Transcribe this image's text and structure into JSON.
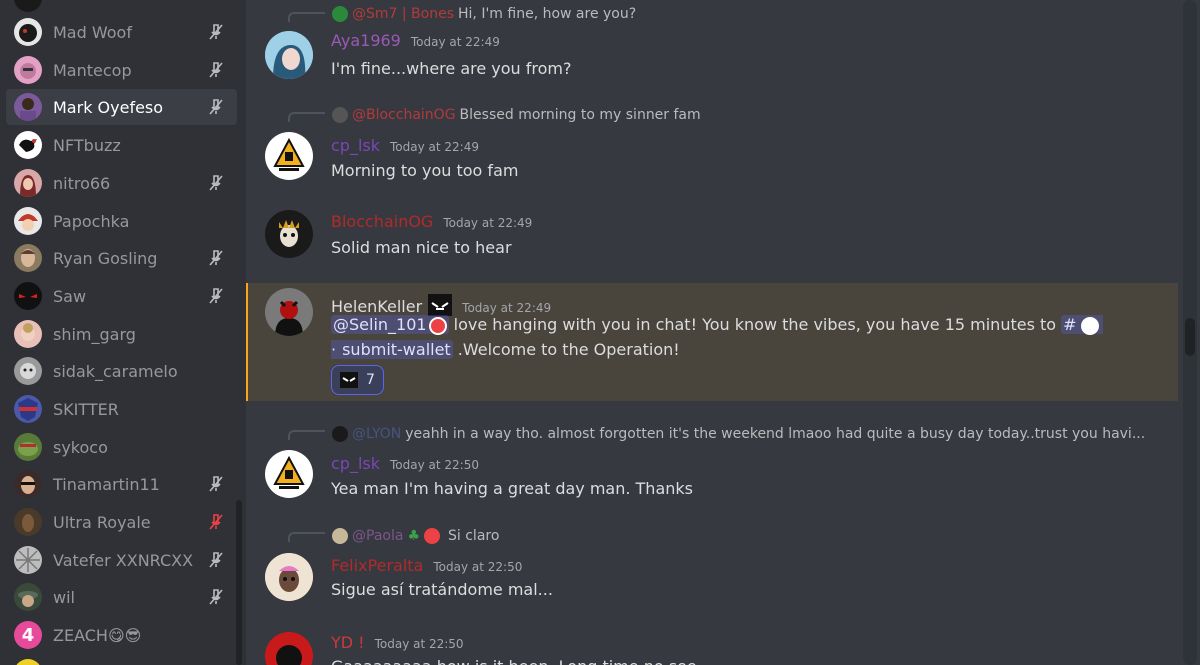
{
  "members": [
    {
      "name": "Mad Woof",
      "muted": true,
      "avatar_color": "#b9bbbe"
    },
    {
      "name": "Mantecop",
      "muted": true,
      "avatar_color": "#e3a1c6"
    },
    {
      "name": "Mark Oyefeso",
      "muted": true,
      "selected": true,
      "avatar_color": "#7a5a9a"
    },
    {
      "name": "NFTbuzz",
      "muted": false,
      "avatar_color": "#ffffff"
    },
    {
      "name": "nitro66",
      "muted": true,
      "avatar_color": "#a85a62"
    },
    {
      "name": "Papochka",
      "muted": false,
      "avatar_color": "#b83a32"
    },
    {
      "name": "Ryan Gosling",
      "muted": true,
      "avatar_color": "#8a7a60"
    },
    {
      "name": "Saw",
      "muted": true,
      "avatar_color": "#1a1a1a"
    },
    {
      "name": "shim_garg",
      "muted": false,
      "avatar_color": "#c98a8a"
    },
    {
      "name": "sidak_caramelo",
      "muted": false,
      "avatar_color": "#8a8a8a"
    },
    {
      "name": "SKITTER",
      "muted": false,
      "avatar_color": "#4a5aa8"
    },
    {
      "name": "sykoco",
      "muted": false,
      "avatar_color": "#6a8a4a"
    },
    {
      "name": "Tinamartin11",
      "muted": true,
      "avatar_color": "#3a2a2a"
    },
    {
      "name": "Ultra Royale",
      "muted": true,
      "mute_red": true,
      "avatar_color": "#4a3a2a"
    },
    {
      "name": "Vatefer XXNRCXX",
      "muted": true,
      "avatar_color": "#9a9a9a"
    },
    {
      "name": "wil",
      "muted": true,
      "avatar_color": "#5a6a5a"
    },
    {
      "name": "ZEACH😋😎",
      "muted": false,
      "avatar_color": "#e84a9a",
      "avatar_letter": "4"
    }
  ],
  "messages": [
    {
      "reply": {
        "name": "@Sm7 | Bones",
        "text": "Hi, I'm fine, how are you?",
        "name_color": "#c93b3b",
        "avatar_color": "#2a8a3a"
      },
      "author": "Aya1969",
      "author_color": "#9b59b6",
      "timestamp": "Today at 22:49",
      "content": "I'm fine...where are you from?",
      "avatar_color": "#6aa8c8"
    },
    {
      "reply": {
        "name": "@BlocchainOG",
        "text": "Blessed morning to my sinner fam",
        "name_color": "#c93b3b",
        "avatar_color": "#555555"
      },
      "author": "cp_lsk",
      "author_color": "#7b46b8",
      "timestamp": "Today at 22:49",
      "content": "Morning to you too fam",
      "avatar_color": "#ffffff"
    },
    {
      "author": "BlocchainOG",
      "author_color": "#b22a2a",
      "timestamp": "Today at 22:49",
      "content": "Solid man nice to hear",
      "avatar_color": "#1a1a1a"
    },
    {
      "author": "HelenKeller",
      "author_color": "#dcddde",
      "timestamp": "Today at 22:49",
      "mention_user": "@Selin_101",
      "content_part1": "love hanging with you in chat! You know the vibes, you have 15 minutes to",
      "channel_prefix": "#",
      "channel_name": "submit-wallet",
      "content_part2": ".Welcome to the Operation!",
      "reaction_count": "7",
      "avatar_color": "#2a2a2a"
    },
    {
      "reply": {
        "name": "@LYON",
        "text": "yeahh in a way tho. almost forgotten it's the weekend lmaoo had quite a busy day today..trust you havi...",
        "name_color": "#4a5a8a",
        "avatar_color": "#1a1a1a"
      },
      "author": "cp_lsk",
      "author_color": "#7b46b8",
      "timestamp": "Today at 22:50",
      "content": "Yea man I'm having a great day man. Thanks",
      "avatar_color": "#ffffff"
    },
    {
      "reply": {
        "name": "@Paola",
        "text": "Si claro",
        "name_color": "#8a5a9a",
        "avatar_color": "#c8b89a"
      },
      "author": "FelixPeralta",
      "author_color": "#b22a2a",
      "timestamp": "Today at 22:50",
      "content": "Sigue así tratándome mal...",
      "avatar_color": "#e8d8c8"
    },
    {
      "author": "YD !",
      "author_color": "#c93b3b",
      "timestamp": "Today at 22:50",
      "content": "Gaaaaaaaaa how is it been. Long time no see",
      "avatar_color": "#c81a1a"
    }
  ]
}
